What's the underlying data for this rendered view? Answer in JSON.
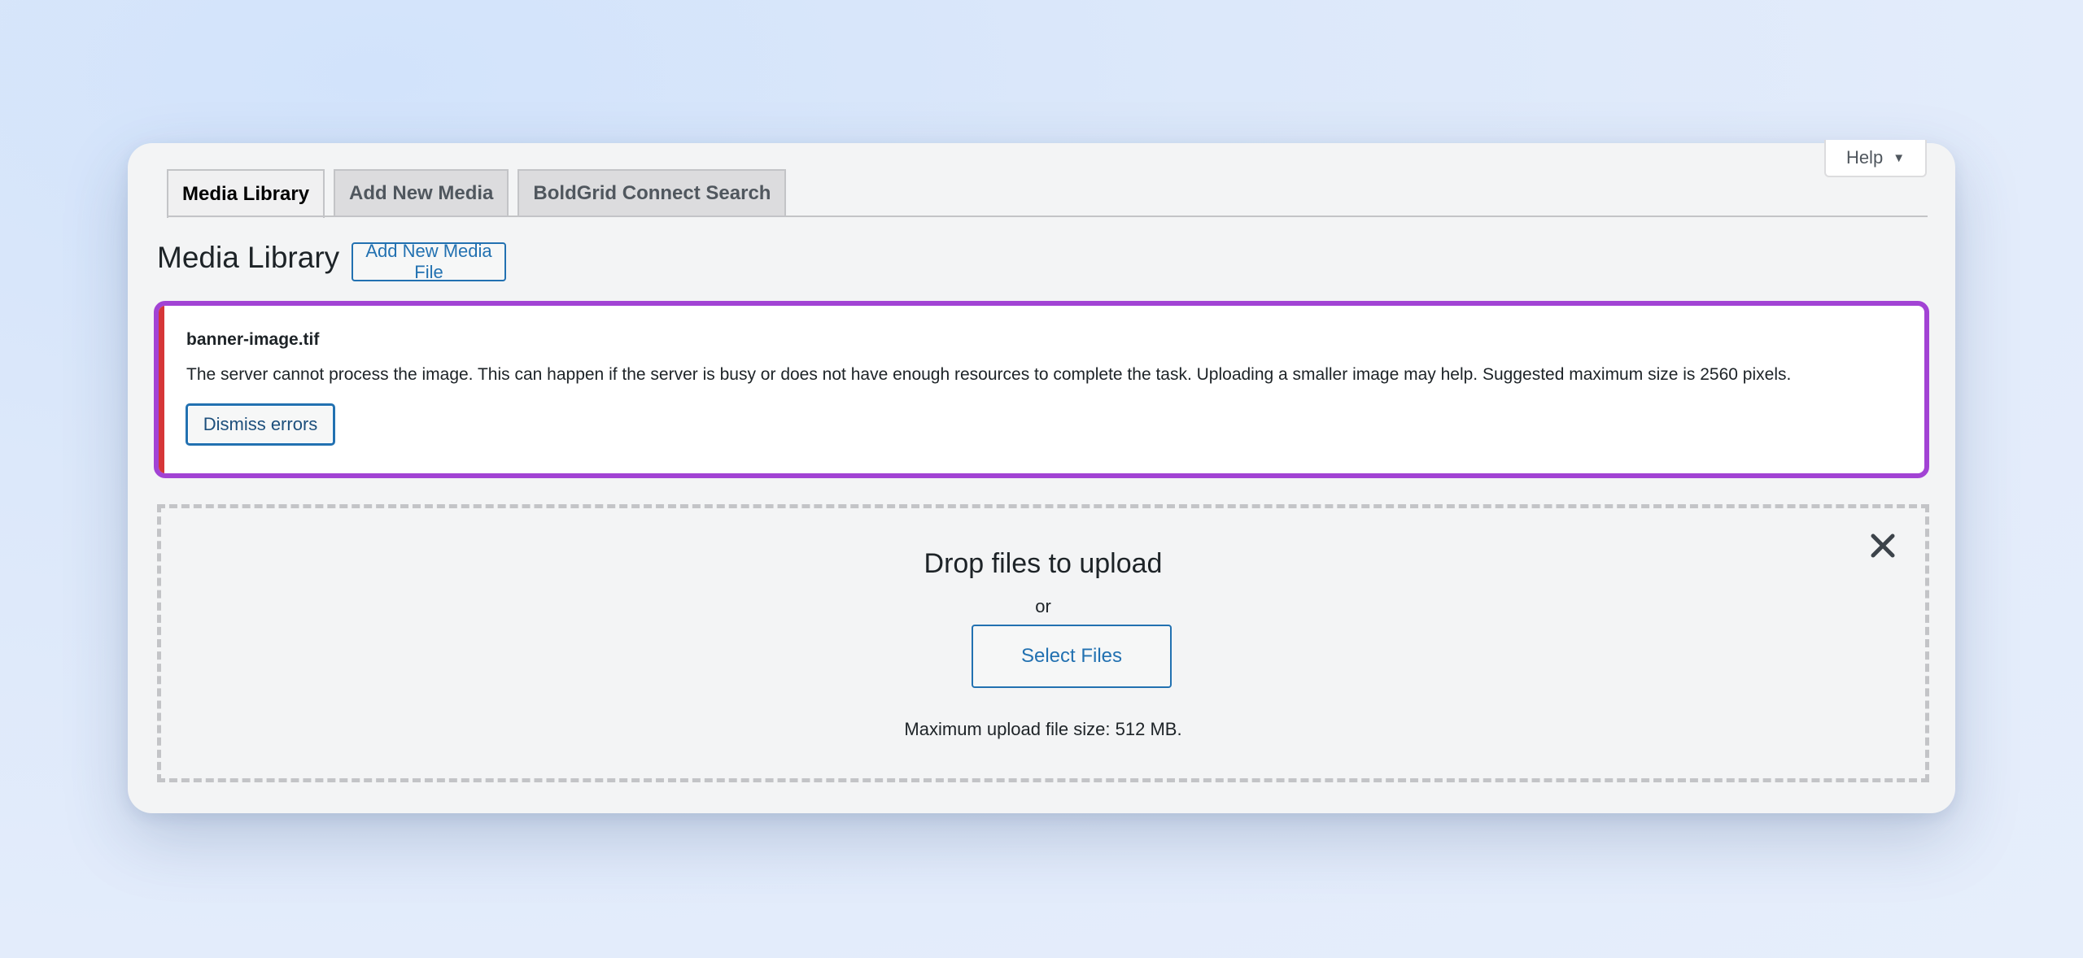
{
  "help": {
    "label": "Help",
    "caret_icon": "triangle-down"
  },
  "tabs": [
    {
      "label": "Media Library",
      "active": true
    },
    {
      "label": "Add New Media",
      "active": false
    },
    {
      "label": "BoldGrid Connect Search",
      "active": false
    }
  ],
  "header": {
    "title": "Media Library",
    "add_new_label": "Add New Media File"
  },
  "error_notice": {
    "filename": "banner-image.tif",
    "message": "The server cannot process the image. This can happen if the server is busy or does not have enough resources to complete the task. Uploading a smaller image may help. Suggested maximum size is 2560 pixels.",
    "dismiss_label": "Dismiss errors",
    "accent_color": "#d63638",
    "highlight_color": "#a243d4"
  },
  "uploader": {
    "title": "Drop files to upload",
    "or_text": "or",
    "select_label": "Select Files",
    "max_size_text": "Maximum upload file size: 512 MB.",
    "close_icon": "close-x"
  },
  "colors": {
    "link_blue": "#2271b1"
  }
}
